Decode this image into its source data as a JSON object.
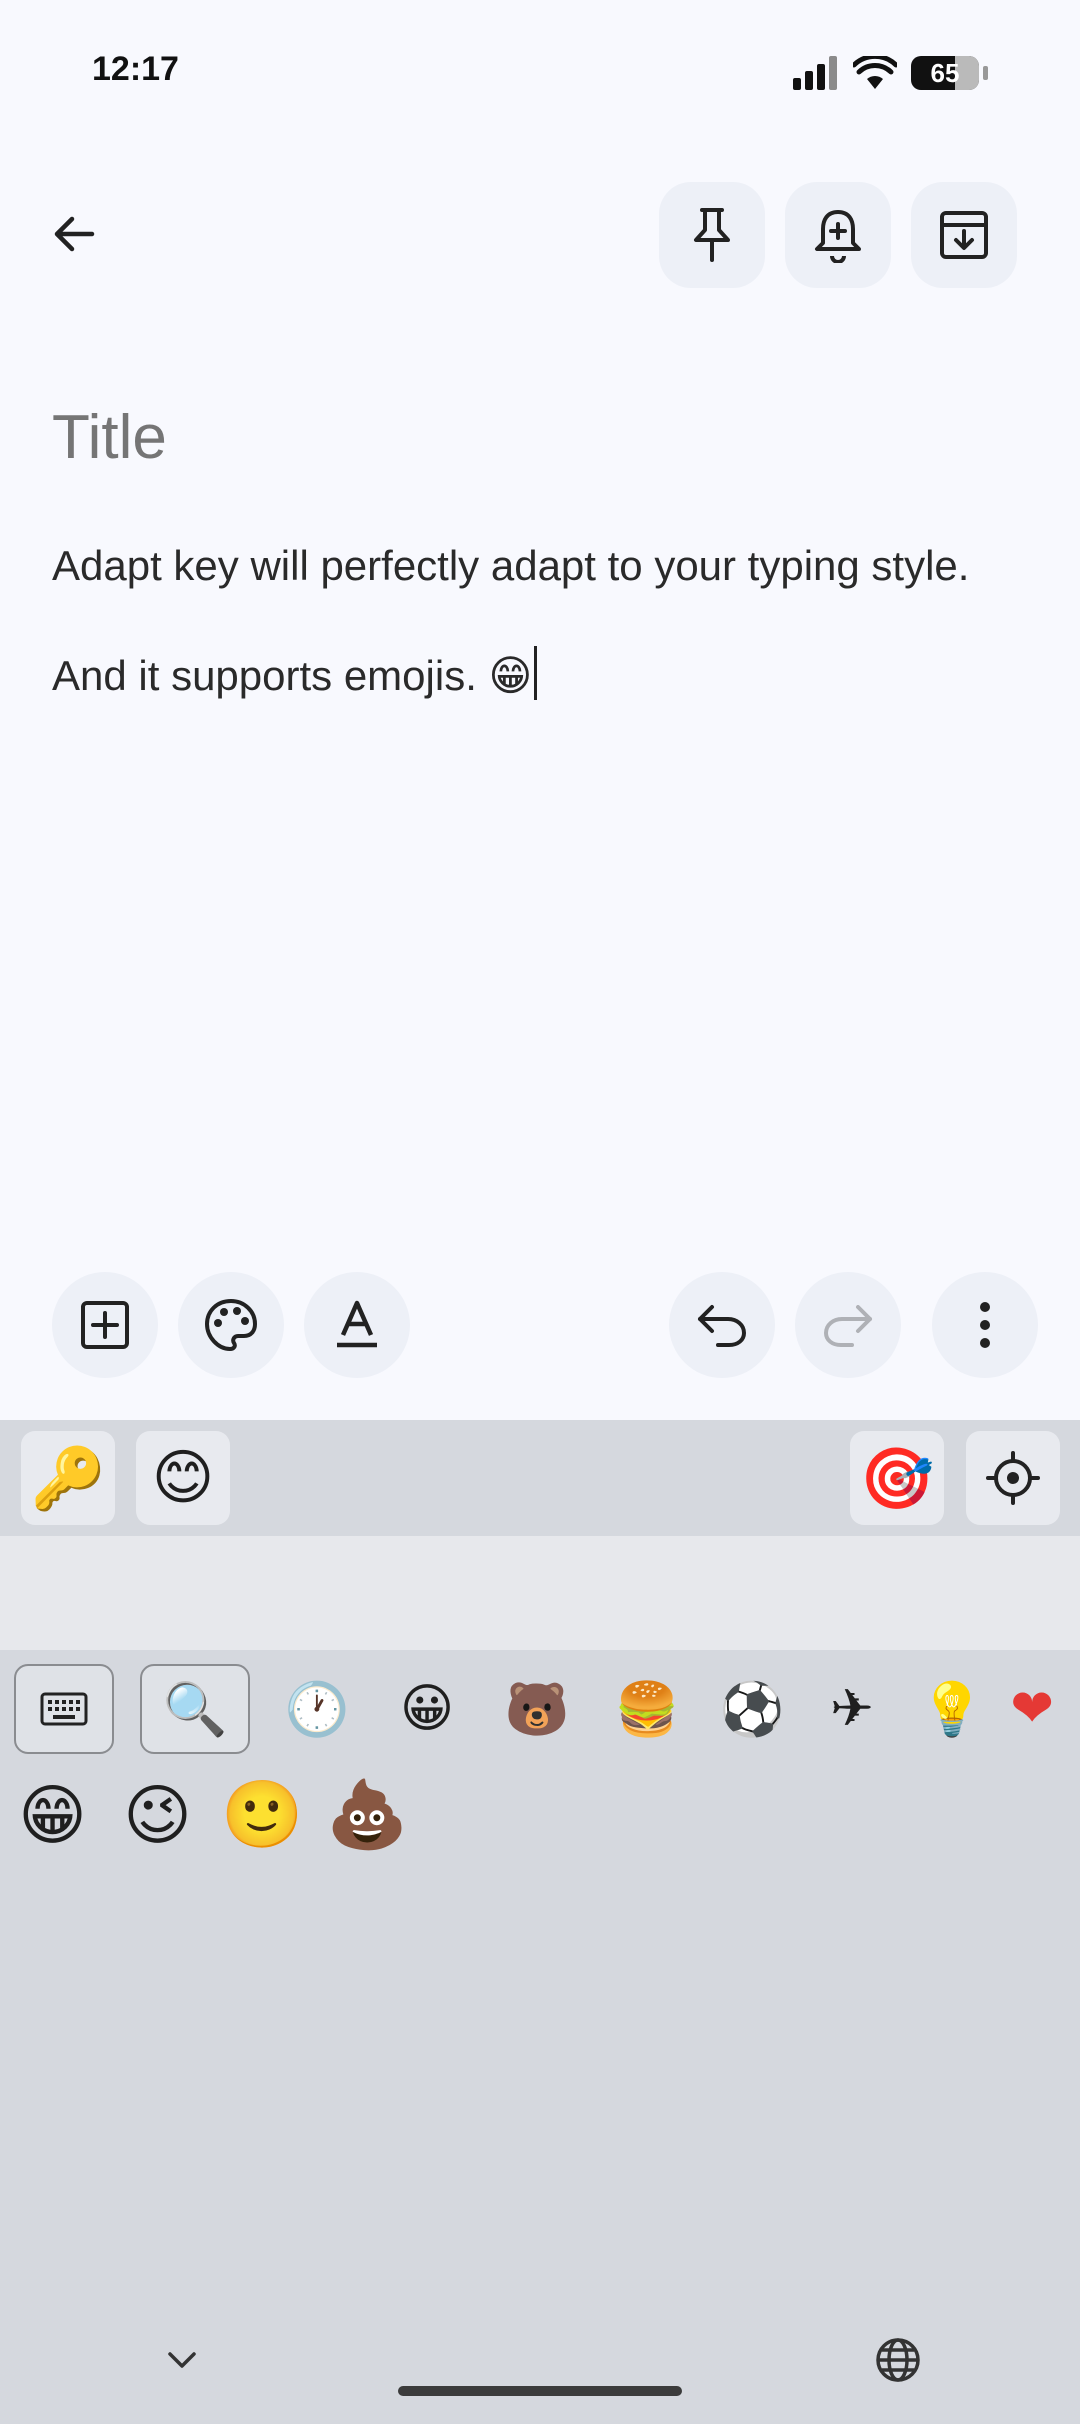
{
  "status_bar": {
    "time": "12:17",
    "battery": "65"
  },
  "note": {
    "title_placeholder": "Title",
    "line1": "Adapt key will perfectly adapt to your typing style.",
    "line2": "And it supports emojis. 😁"
  },
  "icons": {
    "back": "arrow-back-icon",
    "pin": "pin-icon",
    "reminder": "reminder-add-icon",
    "archive": "archive-icon",
    "add_box": "add-box-icon",
    "palette": "palette-icon",
    "text_format": "text-format-icon",
    "undo": "undo-icon",
    "redo": "redo-icon",
    "more": "more-vert-icon"
  },
  "keyboard": {
    "toolbar_left": [
      "🔑",
      "😊"
    ],
    "toolbar_right": [
      "🎯"
    ],
    "categories": [
      "🕐",
      "😀",
      "🐻",
      "🍔",
      "⚽",
      "✈",
      "💡",
      "❤"
    ],
    "recent_emojis": [
      "😁",
      "😉",
      "🙂",
      "💩"
    ]
  },
  "colors": {
    "background": "#f8f9fe",
    "button_bg": "#edf0f7",
    "keyboard_bg": "#d5d8de",
    "suggest_strip": "#e7e8ec"
  }
}
